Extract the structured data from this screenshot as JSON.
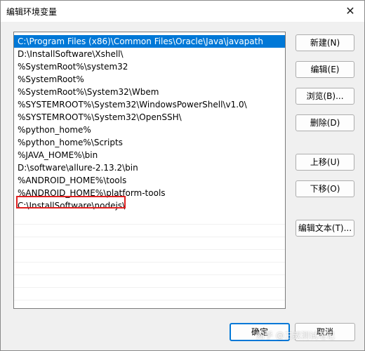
{
  "window": {
    "title": "编辑环境变量",
    "close_glyph": "✕"
  },
  "paths": [
    "C:\\Program Files (x86)\\Common Files\\Oracle\\Java\\javapath",
    "D:\\InstallSoftware\\Xshell\\",
    "%SystemRoot%\\system32",
    "%SystemRoot%",
    "%SystemRoot%\\System32\\Wbem",
    "%SYSTEMROOT%\\System32\\WindowsPowerShell\\v1.0\\",
    "%SYSTEMROOT%\\System32\\OpenSSH\\",
    "%python_home%",
    "%python_home%\\Scripts",
    "%JAVA_HOME%\\bin",
    "D:\\software\\allure-2.13.2\\bin",
    "%ANDROID_HOME%\\tools",
    "%ANDROID_HOME%\\platform-tools",
    "C:\\InstallSoftware\\nodejs\\"
  ],
  "buttons": {
    "new": "新建(N)",
    "edit": "编辑(E)",
    "browse": "浏览(B)...",
    "delete": "删除(D)",
    "move_up": "上移(U)",
    "move_down": "下移(O)",
    "edit_text": "编辑文本(T)...",
    "ok": "确定",
    "cancel": "取消"
  },
  "watermark": "知乎 @三叔测试笔记",
  "colors": {
    "selection": "#0078d7",
    "highlight_box": "#e02020"
  }
}
